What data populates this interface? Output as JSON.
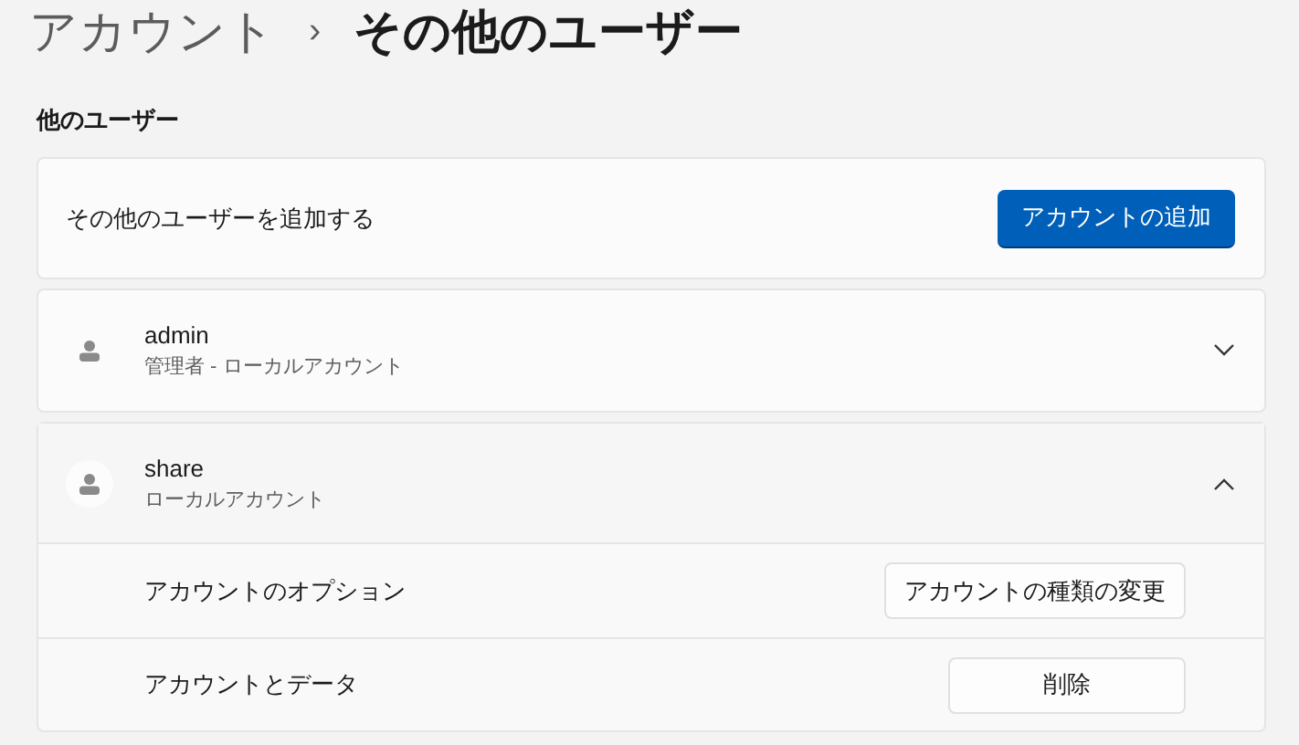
{
  "breadcrumb": {
    "parent": "アカウント",
    "separator": "›",
    "current": "その他のユーザー"
  },
  "section_title": "他のユーザー",
  "add_user": {
    "label": "その他のユーザーを追加する",
    "button": "アカウントの追加"
  },
  "users": [
    {
      "name": "admin",
      "description": "管理者 - ローカルアカウント",
      "expanded": false
    },
    {
      "name": "share",
      "description": "ローカルアカウント",
      "expanded": true,
      "options": [
        {
          "label": "アカウントのオプション",
          "button": "アカウントの種類の変更"
        },
        {
          "label": "アカウントとデータ",
          "button": "削除"
        }
      ]
    }
  ]
}
